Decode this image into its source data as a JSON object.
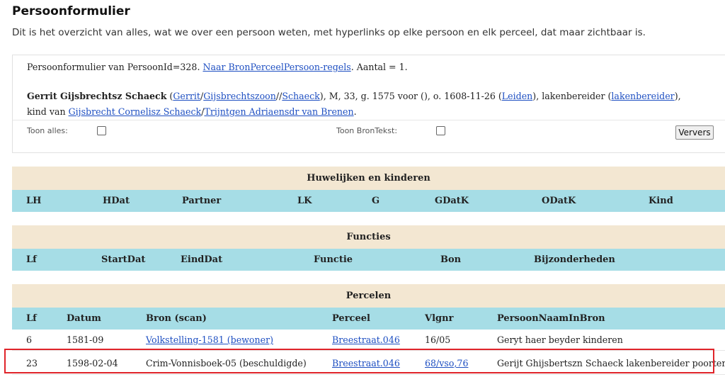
{
  "page": {
    "title": "Persoonformulier",
    "intro": "Dit is het overzicht van alles, wat we over een persoon weten, met hyperlinks op elke persoon en elk perceel, dat maar zichtbaar is."
  },
  "summary": {
    "prefix": "Persoonformulier van PersoonId=328. ",
    "link": "Naar BronPerceelPersoon-regels",
    "suffix": ". Aantal = 1.",
    "name": "Gerrit Gijsbrechtsz Schaeck",
    "open_paren": " (",
    "first": "Gerrit",
    "slash1": "/",
    "patronym": "Gijsbrechtszoon",
    "slash2": "//",
    "surname": "Schaeck",
    "after_surname": "), M, 33, g. 1575 voor (), o. 1608-11-26 (",
    "place": "Leiden",
    "after_place": "), lakenbereider (",
    "occupation": "lakenbereider",
    "after_occupation": "),",
    "kind_prefix": "kind van ",
    "father": "Gijsbrecht Cornelisz Schaeck",
    "slash3": "/",
    "mother": "Trijntgen Adriaensdr van Brenen",
    "end": "."
  },
  "controls": {
    "toon_alles": "Toon alles:",
    "toon_brontekst": "Toon BronTekst:",
    "ververs": "Ververs"
  },
  "huwelijken": {
    "title": "Huwelijken en kinderen",
    "cols": [
      "LH",
      "HDat",
      "Partner",
      "LK",
      "G",
      "GDatK",
      "ODatK",
      "Kind"
    ]
  },
  "functies": {
    "title": "Functies",
    "cols": [
      "Lf",
      "StartDat",
      "EindDat",
      "Functie",
      "Bon",
      "Bijzonderheden"
    ]
  },
  "percelen": {
    "title": "Percelen",
    "cols": [
      "Lf",
      "Datum",
      "Bron (scan)",
      "Perceel",
      "Vlgnr",
      "PersoonNaamInBron"
    ],
    "rows": [
      {
        "lf": "6",
        "datum": "1581-09",
        "bron": "Volkstelling-1581 (bewoner)",
        "perceel": "Breestraat.046",
        "vlgnr": "16/05",
        "naam": "Geryt haer beyder kinderen"
      },
      {
        "lf": "23",
        "datum": "1598-02-04",
        "bron": "Crim-Vonnisboek-05 (beschuldigde)",
        "perceel": "Breestraat.046",
        "vlgnr": "68/vso,76",
        "naam": "Gerijt Ghijsbertszn Schaeck lakenbereider poorter"
      }
    ]
  }
}
